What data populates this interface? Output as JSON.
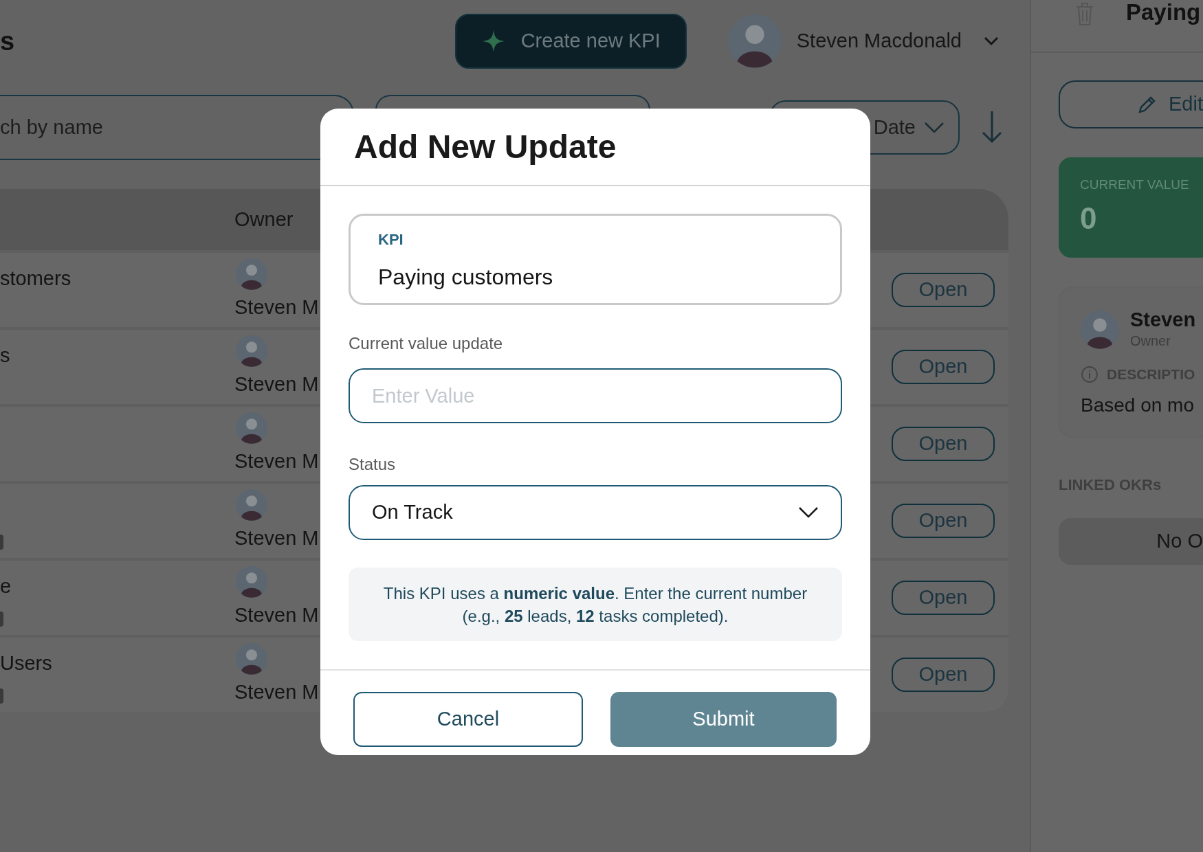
{
  "page": {
    "title": "s",
    "create_button": "Create new KPI",
    "user": {
      "name": "Steven Macdonald"
    }
  },
  "filters": {
    "search": {
      "placeholder": "ch by name"
    },
    "sort": {
      "value": "Date"
    }
  },
  "table": {
    "columns": [
      "Owner"
    ],
    "rows": [
      {
        "name": "stomers",
        "owner": "Steven M",
        "tag": false,
        "action": "Open"
      },
      {
        "name": "s",
        "owner": "Steven M",
        "tag": false,
        "action": "Open"
      },
      {
        "owner": "Steven M",
        "tag": false,
        "action": "Open"
      },
      {
        "owner": "Steven M",
        "tag": true,
        "action": "Open"
      },
      {
        "name": "e",
        "owner": "Steven M",
        "tag": true,
        "action": "Open"
      },
      {
        "name": "Users",
        "owner": "Steven M",
        "tag": true,
        "action": "Open"
      }
    ]
  },
  "dialog": {
    "title": "Add New Update",
    "kpi": {
      "label": "KPI",
      "value": "Paying customers"
    },
    "value_field": {
      "label": "Current value update",
      "placeholder": "Enter Value"
    },
    "status_field": {
      "label": "Status",
      "value": "On Track"
    },
    "info": "This KPI uses a **numeric value**. Enter the current number (e.g., **25** leads, **12** tasks completed).",
    "buttons": {
      "cancel": "Cancel",
      "submit": "Submit"
    }
  },
  "detail": {
    "title": "Paying",
    "edit_button": "Edit",
    "current_value": {
      "label": "CURRENT VALUE",
      "value": "0"
    },
    "owner": {
      "name": "Steven",
      "role": "Owner"
    },
    "description": {
      "label": "DESCRIPTIO",
      "text": "Based on mo"
    },
    "linked": {
      "label": "LINKED OKRs",
      "empty": "No O"
    }
  }
}
